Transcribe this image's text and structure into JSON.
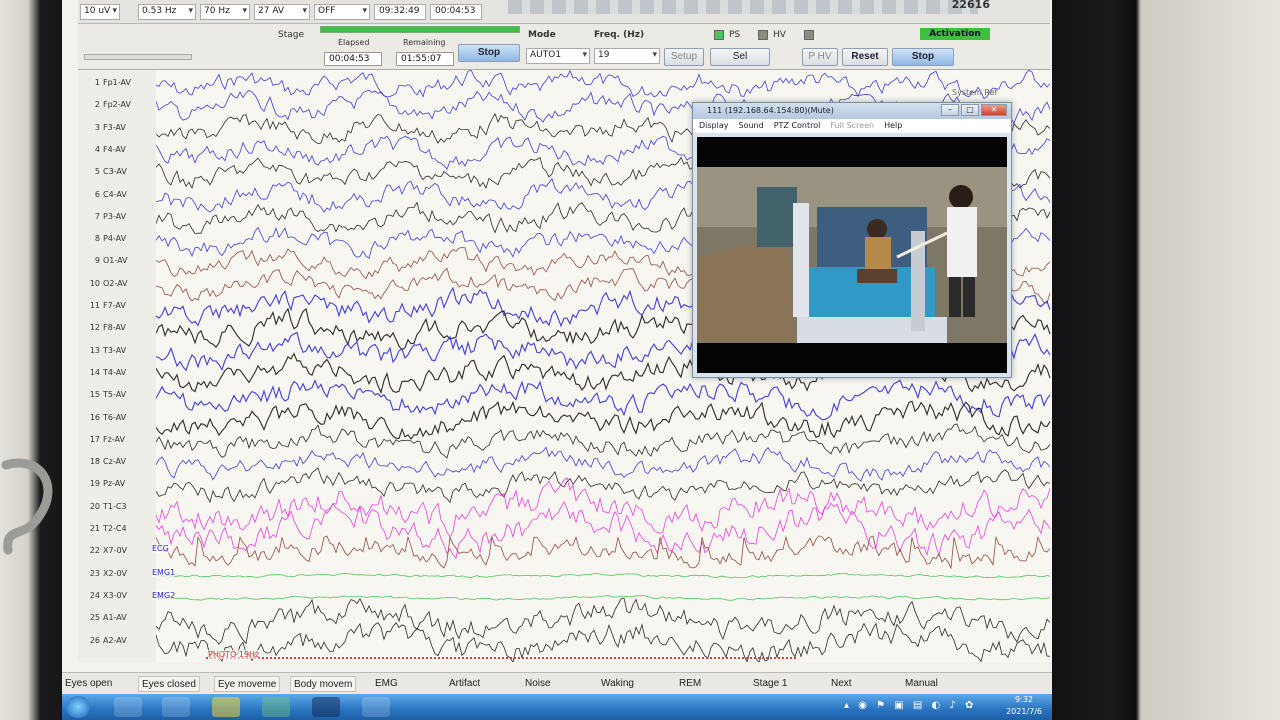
{
  "toolbar": {
    "sensitivity": "10 uV",
    "lowfreq": "0.53 Hz",
    "highfreq": "70 Hz",
    "speed": "27 AV",
    "notch": "OFF",
    "clock_time": "09:32:49",
    "elapsed_top": "00:04:53",
    "counter": "22616"
  },
  "control": {
    "stage_label": "Stage",
    "elapsed_label": "Elapsed",
    "remaining_label": "Remaining",
    "elapsed_value": "00:04:53",
    "remaining_value": "01:55:07",
    "stop_label": "Stop",
    "mode_label": "Mode",
    "mode_value": "AUTO1",
    "freq_label": "Freq. (Hz)",
    "freq_value": "19",
    "setup_label": "Setup",
    "sel_label": "Sel",
    "ps_label": "PS",
    "hv_label": "HV",
    "activation_label": "Activation",
    "phv_label": "P HV",
    "reset_label": "Reset",
    "stop2_label": "Stop"
  },
  "channels": [
    {
      "n": "1",
      "name": "Fp1-AV"
    },
    {
      "n": "2",
      "name": "Fp2-AV"
    },
    {
      "n": "3",
      "name": "F3-AV"
    },
    {
      "n": "4",
      "name": "F4-AV"
    },
    {
      "n": "5",
      "name": "C3-AV"
    },
    {
      "n": "6",
      "name": "C4-AV"
    },
    {
      "n": "7",
      "name": "P3-AV"
    },
    {
      "n": "8",
      "name": "P4-AV"
    },
    {
      "n": "9",
      "name": "O1-AV"
    },
    {
      "n": "10",
      "name": "O2-AV"
    },
    {
      "n": "11",
      "name": "F7-AV"
    },
    {
      "n": "12",
      "name": "F8-AV"
    },
    {
      "n": "13",
      "name": "T3-AV"
    },
    {
      "n": "14",
      "name": "T4-AV"
    },
    {
      "n": "15",
      "name": "T5-AV"
    },
    {
      "n": "16",
      "name": "T6-AV"
    },
    {
      "n": "17",
      "name": "Fz-AV"
    },
    {
      "n": "18",
      "name": "Cz-AV"
    },
    {
      "n": "19",
      "name": "Pz-AV"
    },
    {
      "n": "20",
      "name": "T1-C3"
    },
    {
      "n": "21",
      "name": "T2-C4"
    },
    {
      "n": "22",
      "name": "X7-0V"
    },
    {
      "n": "23",
      "name": "X2-0V"
    },
    {
      "n": "24",
      "name": "X3-0V"
    },
    {
      "n": "25",
      "name": "A1-AV"
    },
    {
      "n": "26",
      "name": "A2-AV"
    }
  ],
  "channel_tags": {
    "ecg": "ECG",
    "emg1": "EMG1",
    "emg2": "EMG2",
    "photic": "PHOTO 19Hz"
  },
  "video": {
    "title": "111 (192.168.64.154:80)(Mute)",
    "menu": [
      "Display",
      "Sound",
      "PTZ Control",
      "Full Screen",
      "Help"
    ],
    "system_ref": "System Ref"
  },
  "events": [
    "Eyes open",
    "Eyes closed",
    "Eye moveme",
    "Body movem",
    "EMG",
    "Artifact",
    "Noise",
    "Waking",
    "REM",
    "Stage 1",
    "Next",
    "Manual"
  ],
  "taskbar": {
    "time": "9:32",
    "date": "2021/7/6"
  },
  "colors": {
    "blue": "#2a2ad8",
    "black": "#141414",
    "brown": "#8b3a2a",
    "magenta": "#ec2ce0",
    "green": "#3ec04a"
  }
}
